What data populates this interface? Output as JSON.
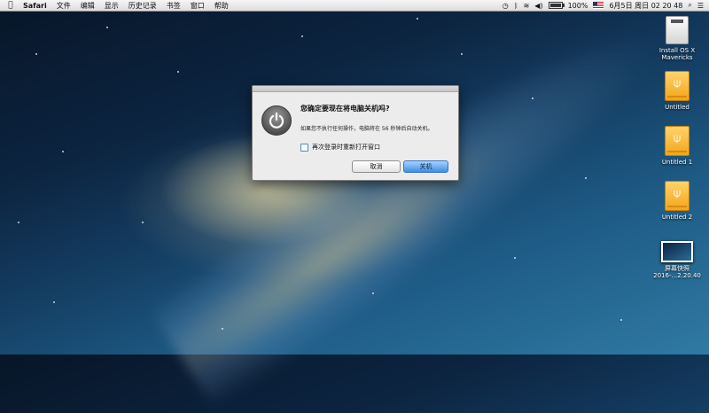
{
  "menubar": {
    "apple_icon": "apple-icon",
    "app_name": "Safari",
    "menus": [
      "文件",
      "编辑",
      "显示",
      "历史记录",
      "书签",
      "窗口",
      "帮助"
    ],
    "battery_percent": 100,
    "battery_label": "100%",
    "datetime": "6月5日 周日  02 20 48"
  },
  "dialog": {
    "title": "您确定要现在将电脑关机吗?",
    "message": "如果您不执行任何操作，电脑将在 56 秒钟后自动关机。",
    "reopen_label": "再次登录时重新打开窗口",
    "reopen_checked": false,
    "cancel_label": "取消",
    "shutdown_label": "关机",
    "accent_color": "#3e8ee8"
  },
  "desktop": {
    "icons": [
      {
        "label": "Install OS X Mavericks",
        "icon": "disk-icon"
      },
      {
        "label": "Untitled",
        "icon": "usb-drive-icon"
      },
      {
        "label": "Untitled 1",
        "icon": "usb-drive-icon"
      },
      {
        "label": "Untitled 2",
        "icon": "usb-drive-icon"
      },
      {
        "label_line1": "屏幕快照",
        "label_line2": "2016-...2.20.40",
        "icon": "screenshot-icon"
      }
    ]
  }
}
